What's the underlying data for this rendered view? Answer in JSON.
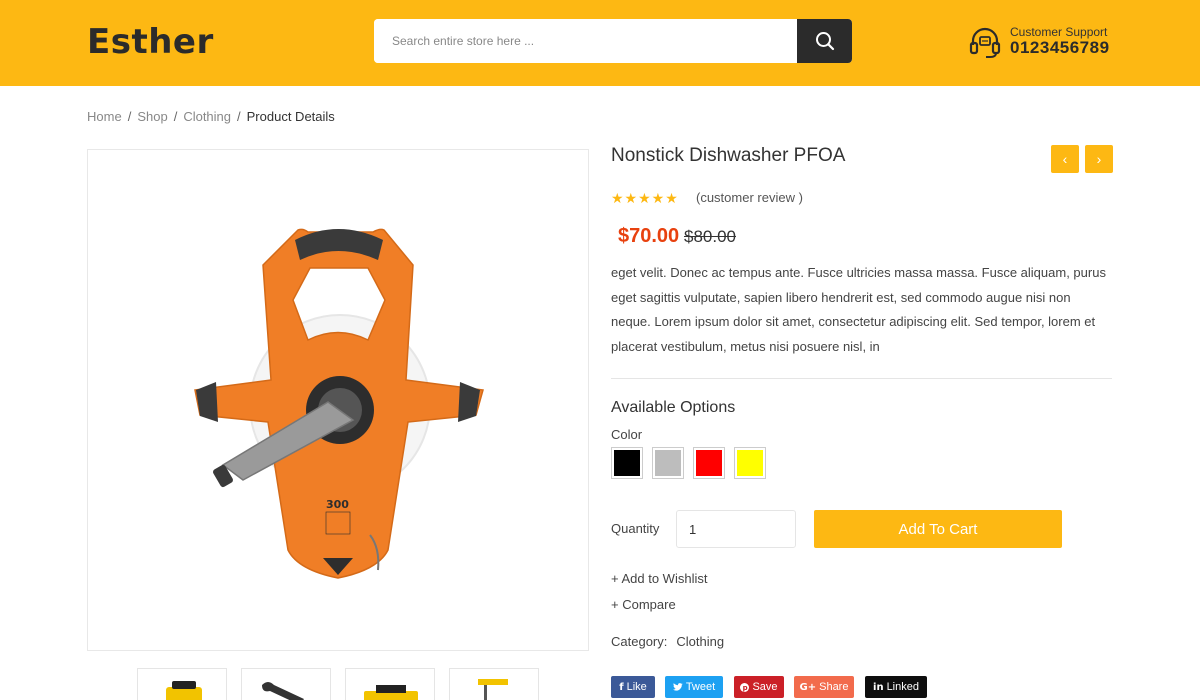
{
  "header": {
    "logo": "Esther",
    "search_placeholder": "Search entire store here ...",
    "support_label": "Customer Support",
    "support_phone": "0123456789",
    "bg_color": "#fdb813"
  },
  "breadcrumb": [
    "Home",
    "Shop",
    "Clothing",
    "Product Details"
  ],
  "product": {
    "title": "Nonstick Dishwasher PFOA",
    "rating": 5,
    "stars": "★★★★★",
    "review_text": "(customer review )",
    "price": "$70.00",
    "old_price": "$80.00",
    "description": "eget velit. Donec ac tempus ante. Fusce ultricies massa massa. Fusce aliquam, purus eget sagittis vulputate, sapien libero hendrerit est, sed commodo augue nisi non neque. Lorem ipsum dolor sit amet, consectetur adipiscing elit. Sed tempor, lorem et placerat vestibulum, metus nisi posuere nisl, in",
    "options_title": "Available Options",
    "color_label": "Color",
    "colors": [
      "#000000",
      "#bdbdbd",
      "#ff0000",
      "#ffff00"
    ],
    "quantity_label": "Quantity",
    "quantity_value": "1",
    "add_to_cart": "Add To Cart",
    "wishlist": "+ Add to Wishlist",
    "compare": "+ Compare",
    "category_label": "Category:",
    "category_value": "Clothing"
  },
  "share": [
    {
      "label": "Like",
      "icon": "f",
      "color": "#3b5998"
    },
    {
      "label": "Tweet",
      "icon": "twitter",
      "color": "#1da1f2"
    },
    {
      "label": "Save",
      "icon": "pinterest",
      "color": "#cb2027"
    },
    {
      "label": "Share",
      "icon": "G+",
      "color": "#dd4b39"
    },
    {
      "label": "Linked",
      "icon": "in",
      "color": "#0e0e0e"
    }
  ],
  "nav": {
    "prev": "‹",
    "next": "›"
  }
}
